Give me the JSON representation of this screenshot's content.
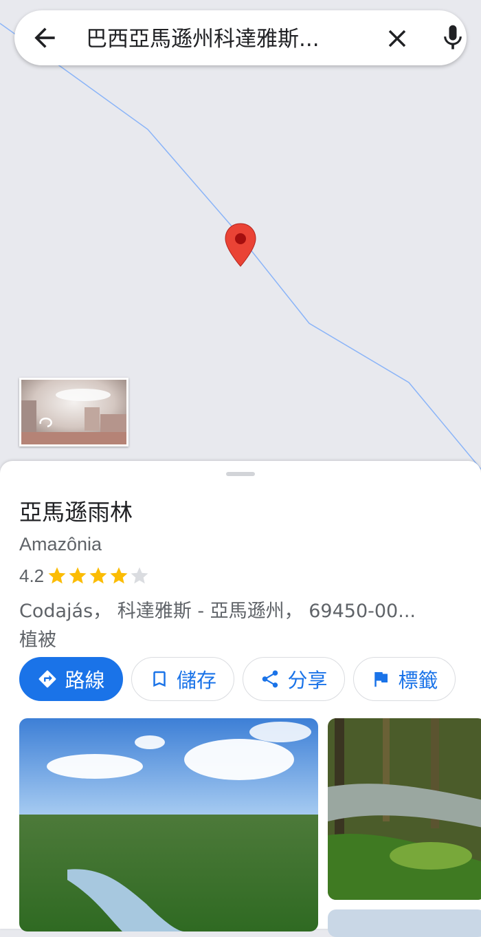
{
  "search": {
    "query": "巴西亞馬遜州科達雅斯...",
    "back_icon": "arrow-left-icon",
    "clear_icon": "close-icon",
    "mic_icon": "microphone-icon"
  },
  "map": {
    "pin_color": "#ea4335",
    "boundary_color": "#8ab4f8",
    "background_color": "#e8e9ee"
  },
  "place": {
    "name": "亞馬遜雨林",
    "alt_name": "Amazônia",
    "rating": "4.2",
    "rating_value": 4.2,
    "stars_filled": 4,
    "stars_total": 5,
    "address": "Codajás， 科達雅斯 - 亞馬遜州， 69450-00...",
    "category": "植被"
  },
  "actions": [
    {
      "label": "路線",
      "icon": "directions-icon"
    },
    {
      "label": "儲存",
      "icon": "bookmark-icon"
    },
    {
      "label": "分享",
      "icon": "share-icon"
    },
    {
      "label": "標籤",
      "icon": "flag-icon"
    }
  ],
  "colors": {
    "accent": "#1a73e8",
    "star": "#fbbc04",
    "star_empty": "#dadce0"
  }
}
